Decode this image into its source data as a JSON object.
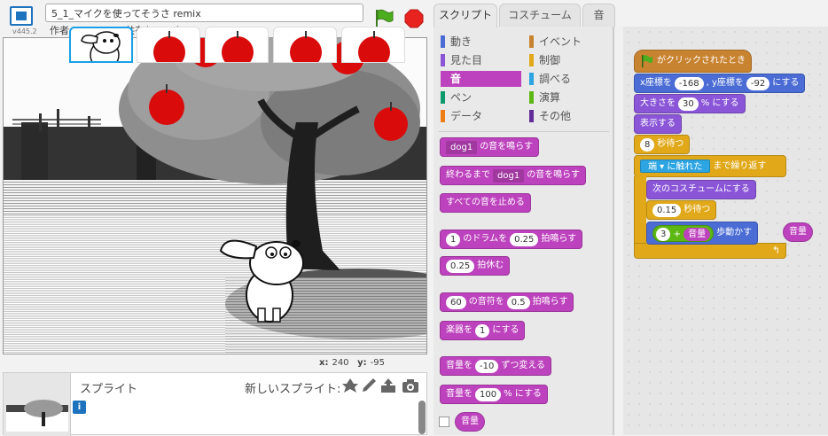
{
  "header": {
    "version": "v445.2",
    "project_title": "5_1_マイクを使ってそうさ remix",
    "author": "作者 kent4989 (共有していない)"
  },
  "stage": {
    "x_label": "x:",
    "x_value": "240",
    "y_label": "y:",
    "y_value": "-95"
  },
  "sprites": {
    "label": "スプライト",
    "new_label": "新しいスプライト:",
    "info": "i"
  },
  "tabs": [
    "スクリプト",
    "コスチューム",
    "音"
  ],
  "categories": [
    {
      "label": "動き",
      "color": "#4a6cd4"
    },
    {
      "label": "イベント",
      "color": "#c88330"
    },
    {
      "label": "見た目",
      "color": "#8a55d7"
    },
    {
      "label": "制御",
      "color": "#e1a91a"
    },
    {
      "label": "音",
      "color": "#bd42bd"
    },
    {
      "label": "調べる",
      "color": "#2ca5e2"
    },
    {
      "label": "ペン",
      "color": "#0e9a6c"
    },
    {
      "label": "演算",
      "color": "#5cb712"
    },
    {
      "label": "データ",
      "color": "#ee7d16"
    },
    {
      "label": "その他",
      "color": "#632d99"
    }
  ],
  "palette": {
    "play_sound": {
      "sound": "dog1",
      "text": "の音を鳴らす"
    },
    "play_until": {
      "prefix": "終わるまで",
      "sound": "dog1",
      "text": "の音を鳴らす"
    },
    "stop_all": "すべての音を止める",
    "drum": {
      "drum": "1",
      "text1": "のドラムを",
      "beats": "0.25",
      "text2": "拍鳴らす"
    },
    "rest": {
      "beats": "0.25",
      "text": "拍休む"
    },
    "note": {
      "note": "60",
      "text1": "の音符を",
      "beats": "0.5",
      "text2": "拍鳴らす"
    },
    "instrument": {
      "prefix": "楽器を",
      "value": "1",
      "text": "にする"
    },
    "change_volume": {
      "prefix": "音量を",
      "value": "-10",
      "text": "ずつ変える"
    },
    "set_volume": {
      "prefix": "音量を",
      "value": "100",
      "text": "% にする"
    },
    "volume_reporter": "音量"
  },
  "script": {
    "hat": "がクリックされたとき",
    "goto": {
      "t1": "x座標を",
      "x": "-168",
      "t2": ", y座標を",
      "y": "-92",
      "t3": "にする"
    },
    "size": {
      "t1": "大きさを",
      "v": "30",
      "t2": "% にする"
    },
    "show": "表示する",
    "wait1": {
      "v": "8",
      "t": "秒待つ"
    },
    "repeat": {
      "edge": "端",
      "t1": "に触れた",
      "t2": "まで繰り返す"
    },
    "next_costume": "次のコスチュームにする",
    "wait2": {
      "v": "0.15",
      "t": "秒待つ"
    },
    "move": {
      "n": "3",
      "plus": "+",
      "vol": "音量",
      "t": "歩動かす"
    },
    "loose_reporter": "音量"
  }
}
